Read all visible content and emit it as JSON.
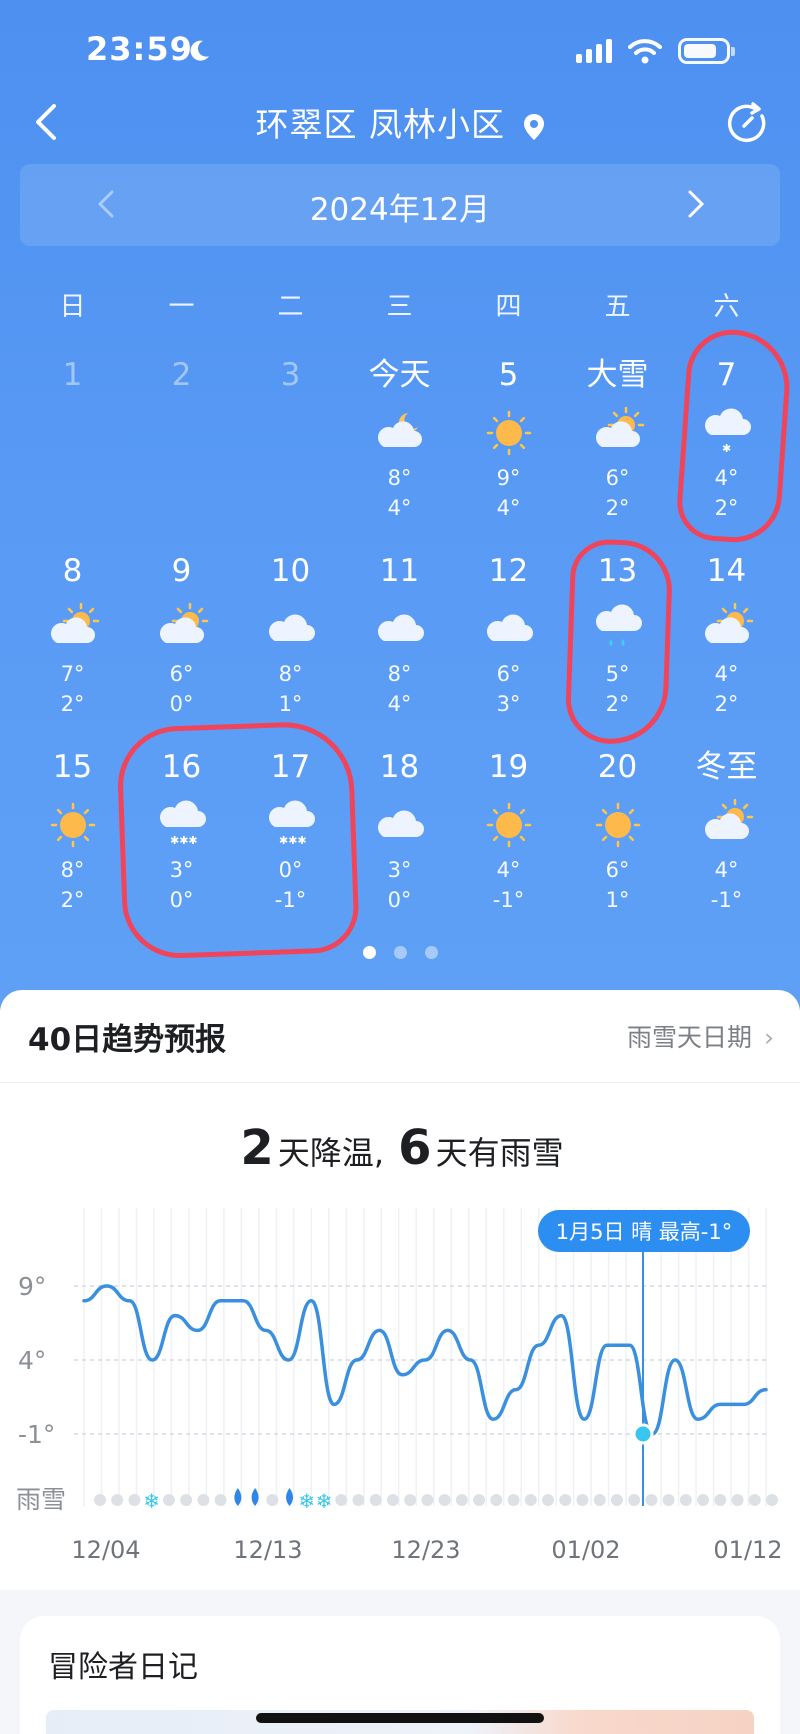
{
  "status": {
    "time": "23:59"
  },
  "header": {
    "location": "环翠区 凤林小区"
  },
  "month_nav": {
    "label": "2024年12月"
  },
  "weekdays": [
    "日",
    "一",
    "二",
    "三",
    "四",
    "五",
    "六"
  ],
  "calendar": {
    "rows": [
      [
        {
          "label": "1",
          "past": true
        },
        {
          "label": "2",
          "past": true
        },
        {
          "label": "3",
          "past": true
        },
        {
          "label": "今天",
          "icon": "partly-cloudy-night-icon",
          "high": "8°",
          "low": "4°"
        },
        {
          "label": "5",
          "icon": "sunny-icon",
          "high": "9°",
          "low": "4°"
        },
        {
          "label": "大雪",
          "icon": "partly-cloudy-icon",
          "high": "6°",
          "low": "2°"
        },
        {
          "label": "7",
          "icon": "light-snow-icon",
          "high": "4°",
          "low": "2°"
        }
      ],
      [
        {
          "label": "8",
          "icon": "partly-cloudy-icon",
          "high": "7°",
          "low": "2°"
        },
        {
          "label": "9",
          "icon": "partly-cloudy-icon",
          "high": "6°",
          "low": "0°"
        },
        {
          "label": "10",
          "icon": "cloudy-icon",
          "high": "8°",
          "low": "1°"
        },
        {
          "label": "11",
          "icon": "cloudy-icon",
          "high": "8°",
          "low": "4°"
        },
        {
          "label": "12",
          "icon": "cloudy-icon",
          "high": "6°",
          "low": "3°"
        },
        {
          "label": "13",
          "icon": "rain-icon",
          "high": "5°",
          "low": "2°"
        },
        {
          "label": "14",
          "icon": "partly-cloudy-icon",
          "high": "4°",
          "low": "2°"
        }
      ],
      [
        {
          "label": "15",
          "icon": "sunny-icon",
          "high": "8°",
          "low": "2°"
        },
        {
          "label": "16",
          "icon": "snow-icon",
          "high": "3°",
          "low": "0°"
        },
        {
          "label": "17",
          "icon": "snow-icon",
          "high": "0°",
          "low": "-1°"
        },
        {
          "label": "18",
          "icon": "cloudy-icon",
          "high": "3°",
          "low": "0°"
        },
        {
          "label": "19",
          "icon": "sunny-icon",
          "high": "4°",
          "low": "-1°"
        },
        {
          "label": "20",
          "icon": "sunny-icon",
          "high": "6°",
          "low": "1°"
        },
        {
          "label": "冬至",
          "icon": "partly-cloudy-icon",
          "high": "4°",
          "low": "-1°"
        }
      ]
    ]
  },
  "pager": {
    "count": 3,
    "active": 0
  },
  "trend": {
    "title": "40日趋势预报",
    "link": "雨雪天日期",
    "summary_cooling_num": "2",
    "summary_cooling_text": "天降温,",
    "summary_precip_num": "6",
    "summary_precip_text": "天有雨雪",
    "tooltip": "1月5日 晴 最高-1°",
    "precip_label": "雨雪"
  },
  "chart_data": {
    "type": "line",
    "ylabels": [
      "9°",
      "4°",
      "-1°"
    ],
    "ylim": [
      -1,
      9
    ],
    "x_tick_labels": [
      "12/04",
      "12/13",
      "12/23",
      "01/02",
      "01/12"
    ],
    "series": [
      {
        "values": [
          8,
          9,
          8,
          4,
          7,
          6,
          8,
          8,
          6,
          4,
          8,
          1,
          4,
          6,
          3,
          4,
          6,
          4,
          0,
          2,
          5,
          7,
          0,
          5,
          5,
          -1,
          4,
          0,
          1,
          1,
          2
        ]
      }
    ],
    "highlight": {
      "date": "01/05",
      "value": -1
    },
    "precip_days": [
      "light-snow",
      "rain",
      "rain",
      "rain",
      "snow",
      "snow"
    ]
  },
  "diary": {
    "title": "冒险者日记"
  },
  "colors": {
    "accent": "#4d90f0",
    "line": "#3a8fde",
    "highlight_circle": "#f0445a"
  }
}
